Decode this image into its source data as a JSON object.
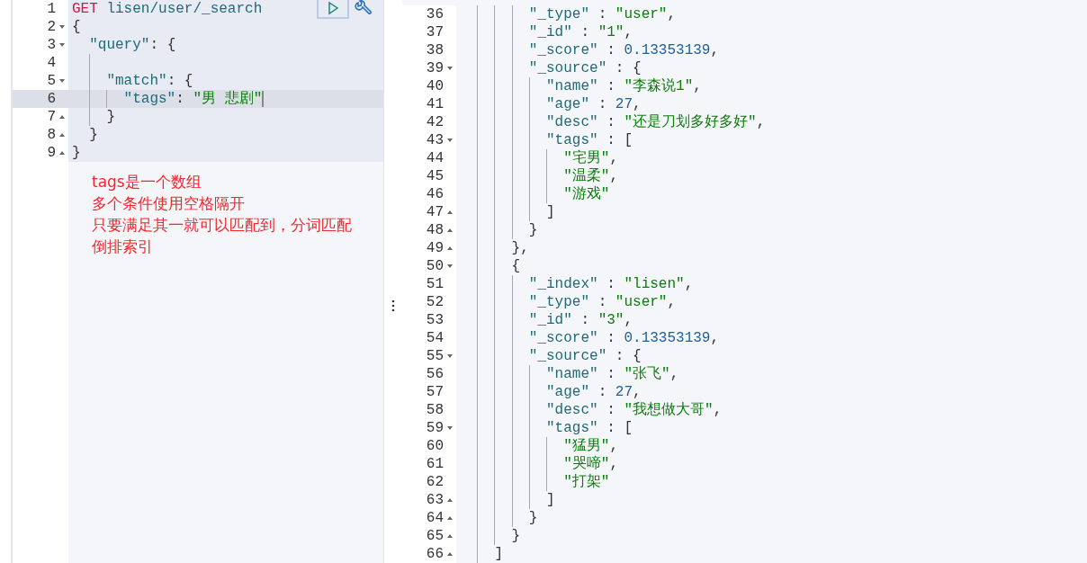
{
  "request_editor": {
    "lines": [
      {
        "number": "1",
        "kind": "plain",
        "active": false,
        "tokens": [
          {
            "kind": "method",
            "text": "GET"
          },
          {
            "kind": "url",
            "text": " lisen/user/_search"
          }
        ]
      },
      {
        "number": "2",
        "kind": "opener",
        "active": false,
        "tokens": [
          {
            "kind": "punct",
            "text": "{"
          }
        ]
      },
      {
        "number": "3",
        "kind": "opener",
        "active": false,
        "tokens": [
          {
            "kind": "key",
            "text": "  \"query\""
          },
          {
            "kind": "punct",
            "text": ": {"
          }
        ]
      },
      {
        "number": "4",
        "kind": "plain",
        "active": false
      },
      {
        "number": "5",
        "kind": "opener",
        "active": false,
        "tokens": [
          {
            "kind": "key",
            "text": "    \"match\""
          },
          {
            "kind": "punct",
            "text": ": {"
          }
        ]
      },
      {
        "number": "6",
        "kind": "plain",
        "active": true,
        "tokens": [
          {
            "kind": "key",
            "text": "      \"tags\""
          },
          {
            "kind": "punct",
            "text": ": "
          },
          {
            "kind": "string",
            "text": "\"男 悲剧\""
          }
        ]
      },
      {
        "number": "7",
        "kind": "closer",
        "active": false,
        "tokens": [
          {
            "kind": "punct",
            "text": "    }"
          }
        ]
      },
      {
        "number": "8",
        "kind": "closer",
        "active": false,
        "tokens": [
          {
            "kind": "punct",
            "text": "  }"
          }
        ]
      },
      {
        "number": "9",
        "kind": "closer",
        "active": false,
        "tokens": [
          {
            "kind": "punct",
            "text": "}"
          }
        ]
      }
    ]
  },
  "note": {
    "lines": [
      "tags是一个数组",
      "多个条件使用空格隔开",
      "只要满足其一就可以匹配到，分词匹配",
      "倒排索引"
    ]
  },
  "response_viewer": {
    "lines": [
      {
        "number": "36",
        "kind": "plain",
        "tokens": [
          {
            "kind": "key",
            "text": "        \"_type\""
          },
          {
            "kind": "punct",
            "text": " : "
          },
          {
            "kind": "string",
            "text": "\"user\""
          },
          {
            "kind": "punct",
            "text": ","
          }
        ]
      },
      {
        "number": "37",
        "kind": "plain",
        "tokens": [
          {
            "kind": "key",
            "text": "        \"_id\""
          },
          {
            "kind": "punct",
            "text": " : "
          },
          {
            "kind": "string",
            "text": "\"1\""
          },
          {
            "kind": "punct",
            "text": ","
          }
        ]
      },
      {
        "number": "38",
        "kind": "plain",
        "tokens": [
          {
            "kind": "key",
            "text": "        \"_score\""
          },
          {
            "kind": "punct",
            "text": " : "
          },
          {
            "kind": "number",
            "text": "0.13353139"
          },
          {
            "kind": "punct",
            "text": ","
          }
        ]
      },
      {
        "number": "39",
        "kind": "opener",
        "tokens": [
          {
            "kind": "key",
            "text": "        \"_source\""
          },
          {
            "kind": "punct",
            "text": " : {"
          }
        ]
      },
      {
        "number": "40",
        "kind": "plain",
        "tokens": [
          {
            "kind": "key",
            "text": "          \"name\""
          },
          {
            "kind": "punct",
            "text": " : "
          },
          {
            "kind": "string",
            "text": "\"李森说1\""
          },
          {
            "kind": "punct",
            "text": ","
          }
        ]
      },
      {
        "number": "41",
        "kind": "plain",
        "tokens": [
          {
            "kind": "key",
            "text": "          \"age\""
          },
          {
            "kind": "punct",
            "text": " : "
          },
          {
            "kind": "number",
            "text": "27"
          },
          {
            "kind": "punct",
            "text": ","
          }
        ]
      },
      {
        "number": "42",
        "kind": "plain",
        "tokens": [
          {
            "kind": "key",
            "text": "          \"desc\""
          },
          {
            "kind": "punct",
            "text": " : "
          },
          {
            "kind": "string",
            "text": "\"还是刀划多好多好\""
          },
          {
            "kind": "punct",
            "text": ","
          }
        ]
      },
      {
        "number": "43",
        "kind": "opener",
        "tokens": [
          {
            "kind": "key",
            "text": "          \"tags\""
          },
          {
            "kind": "punct",
            "text": " : ["
          }
        ]
      },
      {
        "number": "44",
        "kind": "plain",
        "tokens": [
          {
            "kind": "string",
            "text": "            \"宅男\""
          },
          {
            "kind": "punct",
            "text": ","
          }
        ]
      },
      {
        "number": "45",
        "kind": "plain",
        "tokens": [
          {
            "kind": "string",
            "text": "            \"温柔\""
          },
          {
            "kind": "punct",
            "text": ","
          }
        ]
      },
      {
        "number": "46",
        "kind": "plain",
        "tokens": [
          {
            "kind": "string",
            "text": "            \"游戏\""
          }
        ]
      },
      {
        "number": "47",
        "kind": "closer",
        "tokens": [
          {
            "kind": "punct",
            "text": "          ]"
          }
        ]
      },
      {
        "number": "48",
        "kind": "closer",
        "tokens": [
          {
            "kind": "punct",
            "text": "        }"
          }
        ]
      },
      {
        "number": "49",
        "kind": "closer",
        "tokens": [
          {
            "kind": "punct",
            "text": "      },"
          }
        ]
      },
      {
        "number": "50",
        "kind": "opener",
        "tokens": [
          {
            "kind": "punct",
            "text": "      {"
          }
        ]
      },
      {
        "number": "51",
        "kind": "plain",
        "tokens": [
          {
            "kind": "key",
            "text": "        \"_index\""
          },
          {
            "kind": "punct",
            "text": " : "
          },
          {
            "kind": "string",
            "text": "\"lisen\""
          },
          {
            "kind": "punct",
            "text": ","
          }
        ]
      },
      {
        "number": "52",
        "kind": "plain",
        "tokens": [
          {
            "kind": "key",
            "text": "        \"_type\""
          },
          {
            "kind": "punct",
            "text": " : "
          },
          {
            "kind": "string",
            "text": "\"user\""
          },
          {
            "kind": "punct",
            "text": ","
          }
        ]
      },
      {
        "number": "53",
        "kind": "plain",
        "tokens": [
          {
            "kind": "key",
            "text": "        \"_id\""
          },
          {
            "kind": "punct",
            "text": " : "
          },
          {
            "kind": "string",
            "text": "\"3\""
          },
          {
            "kind": "punct",
            "text": ","
          }
        ]
      },
      {
        "number": "54",
        "kind": "plain",
        "tokens": [
          {
            "kind": "key",
            "text": "        \"_score\""
          },
          {
            "kind": "punct",
            "text": " : "
          },
          {
            "kind": "number",
            "text": "0.13353139"
          },
          {
            "kind": "punct",
            "text": ","
          }
        ]
      },
      {
        "number": "55",
        "kind": "opener",
        "tokens": [
          {
            "kind": "key",
            "text": "        \"_source\""
          },
          {
            "kind": "punct",
            "text": " : {"
          }
        ]
      },
      {
        "number": "56",
        "kind": "plain",
        "tokens": [
          {
            "kind": "key",
            "text": "          \"name\""
          },
          {
            "kind": "punct",
            "text": " : "
          },
          {
            "kind": "string",
            "text": "\"张飞\""
          },
          {
            "kind": "punct",
            "text": ","
          }
        ]
      },
      {
        "number": "57",
        "kind": "plain",
        "tokens": [
          {
            "kind": "key",
            "text": "          \"age\""
          },
          {
            "kind": "punct",
            "text": " : "
          },
          {
            "kind": "number",
            "text": "27"
          },
          {
            "kind": "punct",
            "text": ","
          }
        ]
      },
      {
        "number": "58",
        "kind": "plain",
        "tokens": [
          {
            "kind": "key",
            "text": "          \"desc\""
          },
          {
            "kind": "punct",
            "text": " : "
          },
          {
            "kind": "string",
            "text": "\"我想做大哥\""
          },
          {
            "kind": "punct",
            "text": ","
          }
        ]
      },
      {
        "number": "59",
        "kind": "opener",
        "tokens": [
          {
            "kind": "key",
            "text": "          \"tags\""
          },
          {
            "kind": "punct",
            "text": " : ["
          }
        ]
      },
      {
        "number": "60",
        "kind": "plain",
        "tokens": [
          {
            "kind": "string",
            "text": "            \"猛男\""
          },
          {
            "kind": "punct",
            "text": ","
          }
        ]
      },
      {
        "number": "61",
        "kind": "plain",
        "tokens": [
          {
            "kind": "string",
            "text": "            \"哭啼\""
          },
          {
            "kind": "punct",
            "text": ","
          }
        ]
      },
      {
        "number": "62",
        "kind": "plain",
        "tokens": [
          {
            "kind": "string",
            "text": "            \"打架\""
          }
        ]
      },
      {
        "number": "63",
        "kind": "closer",
        "tokens": [
          {
            "kind": "punct",
            "text": "          ]"
          }
        ]
      },
      {
        "number": "64",
        "kind": "closer",
        "tokens": [
          {
            "kind": "punct",
            "text": "        }"
          }
        ]
      },
      {
        "number": "65",
        "kind": "closer",
        "tokens": [
          {
            "kind": "punct",
            "text": "      }"
          }
        ]
      },
      {
        "number": "66",
        "kind": "closer",
        "tokens": [
          {
            "kind": "punct",
            "text": "    ]"
          }
        ]
      }
    ]
  }
}
